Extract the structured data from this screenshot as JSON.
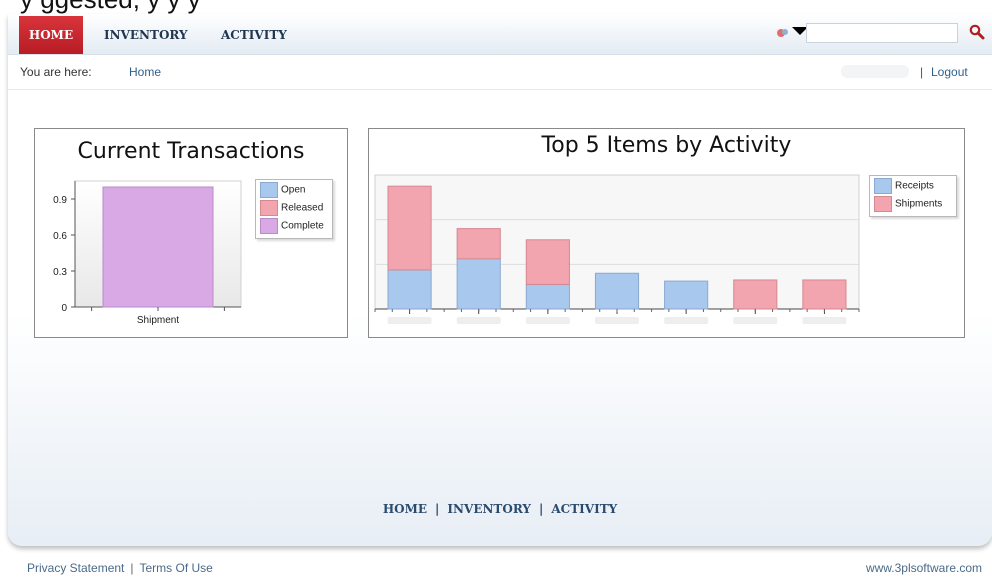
{
  "overlay_text": "y ggested, y                    y                    y",
  "nav": {
    "items": [
      "HOME",
      "INVENTORY",
      "ACTIVITY"
    ],
    "active": "HOME",
    "active_color": "#c8262e"
  },
  "search": {
    "value": "",
    "placeholder": "",
    "icon": "search-icon"
  },
  "language": {
    "icon": "language-flag-icon"
  },
  "breadcrumb": {
    "label": "You are here:",
    "current": "Home"
  },
  "account": {
    "separator": "|",
    "logout": "Logout"
  },
  "chart_data": [
    {
      "type": "bar",
      "title": "Current Transactions",
      "categories": [
        "Shipment"
      ],
      "series": [
        {
          "name": "Open",
          "values": [
            0
          ],
          "color": "#a9c8ee"
        },
        {
          "name": "Released",
          "values": [
            0
          ],
          "color": "#f2a5ae"
        },
        {
          "name": "Complete",
          "values": [
            1
          ],
          "color": "#d9a9e6"
        }
      ],
      "yticks": [
        "0",
        "0.3",
        "0.6",
        "0.9"
      ],
      "ylim": [
        0,
        1.05
      ],
      "legend": "right"
    },
    {
      "type": "bar",
      "stacked": true,
      "title": "Top 5 Items by Activity",
      "categories": [
        "",
        "",
        "",
        "",
        "",
        "",
        ""
      ],
      "series": [
        {
          "name": "Receipts",
          "values": [
            0.35,
            0.45,
            0.22,
            0.32,
            0.25,
            0,
            0
          ],
          "color": "#a9c8ee"
        },
        {
          "name": "Shipments",
          "values": [
            0.75,
            0.27,
            0.4,
            0,
            0,
            0.26,
            0.26
          ],
          "color": "#f2a5ae"
        }
      ],
      "ylim": [
        0,
        1.2
      ],
      "grid": true,
      "legend": "right"
    }
  ],
  "footer_nav": {
    "items": [
      "HOME",
      "INVENTORY",
      "ACTIVITY"
    ],
    "separator": "|"
  },
  "legal": {
    "privacy": "Privacy Statement",
    "separator": "|",
    "terms": "Terms Of Use"
  },
  "site": "www.3plsoftware.com"
}
